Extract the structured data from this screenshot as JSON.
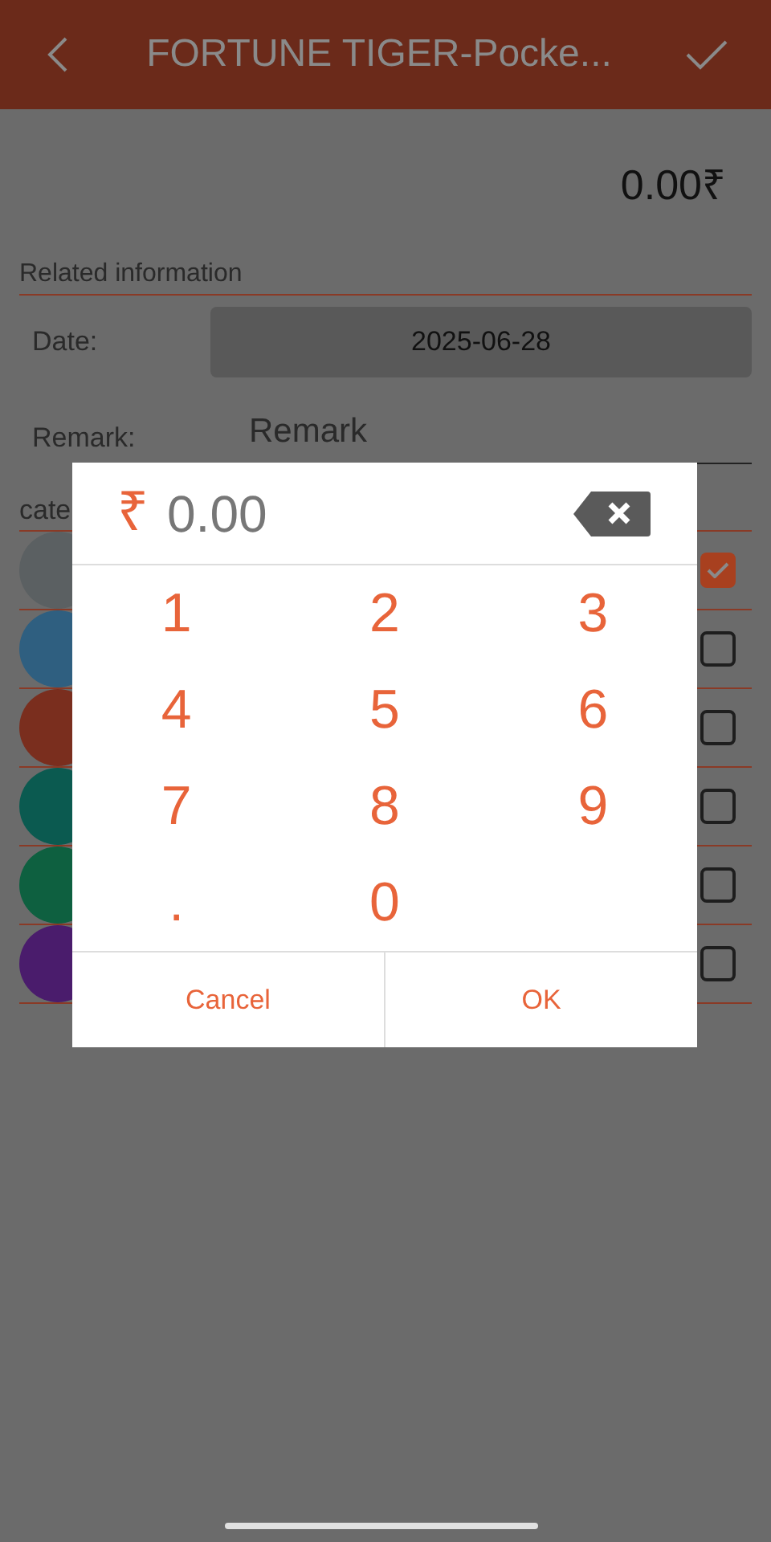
{
  "header": {
    "title": "FORTUNE TIGER-Pocke..."
  },
  "amount": "0.00₹",
  "related": {
    "heading": "Related information",
    "date_label": "Date:",
    "date_value": "2025-06-28",
    "remark_label": "Remark:",
    "remark_placeholder": "Remark"
  },
  "category": {
    "heading": "cate",
    "items": [
      {
        "color": "#5b6062",
        "checked": true
      },
      {
        "color": "#2f5f80",
        "checked": false
      },
      {
        "color": "#7a2e1e",
        "checked": false
      },
      {
        "color": "#0b5a50",
        "checked": false
      },
      {
        "color": "#0e6040",
        "checked": false
      },
      {
        "color": "#4a1c6c",
        "checked": false
      }
    ]
  },
  "keypad": {
    "currency": "₹",
    "value": "0.00",
    "keys": [
      "1",
      "2",
      "3",
      "4",
      "5",
      "6",
      "7",
      "8",
      "9",
      ".",
      "0"
    ],
    "buttons": [
      "Cancel",
      "OK"
    ]
  }
}
